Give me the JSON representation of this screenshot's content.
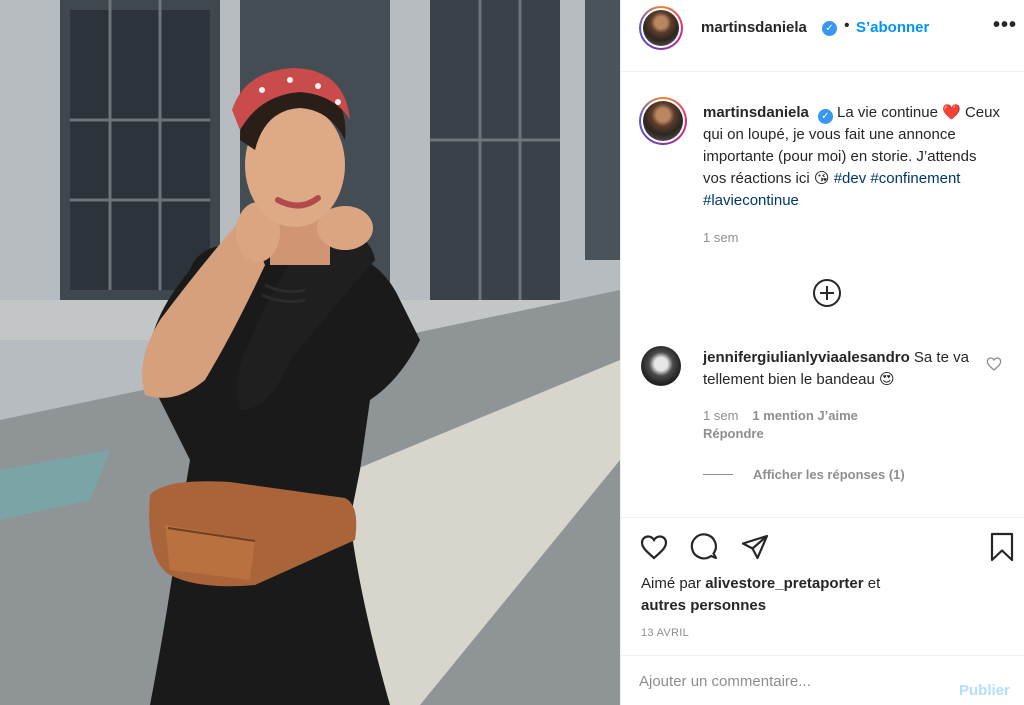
{
  "post": {
    "image_alt": "Femme en combinaison noire avec bandeau et sac banane, dans une rue ensoleillée"
  },
  "header": {
    "username": "martinsdaniela",
    "separator": "•",
    "follow_label": "S’abonner",
    "more_label": "•••"
  },
  "caption": {
    "username": "martinsdaniela",
    "text_line1": "La vie continue ❤️",
    "text_body": "Ceux qui on loupé, je vous fait une annonce importante (pour moi) en storie. J’attends vos réactions ici 😘",
    "hashtags": [
      "#dev",
      "#confinement",
      "#laviecontinue"
    ],
    "time": "1 sem"
  },
  "comments": [
    {
      "username": "jennifergiulianlyviaalesandro",
      "text": "Sa te va tellement bien le bandeau 😍",
      "time": "1 sem",
      "likes": "1 mention J’aime",
      "reply_label": "Répondre",
      "view_replies_label": "Afficher les réponses (1)"
    }
  ],
  "actions": {
    "liked_prefix": "Aimé par",
    "liked_user": "alivestore_pretaporter",
    "liked_conj": "et",
    "liked_others": "autres personnes",
    "date": "13 AVRIL"
  },
  "add_comment": {
    "placeholder": "Ajouter un commentaire...",
    "publish_label": "Publier"
  },
  "icons": {
    "verified": "verified-badge-icon",
    "like": "heart-icon",
    "comment": "comment-bubble-icon",
    "share": "paper-plane-icon",
    "save": "bookmark-icon",
    "load_more": "plus-circle-icon"
  },
  "colors": {
    "link_blue": "#0095f6",
    "hashtag": "#00376b",
    "muted": "#8e8e8e",
    "publish_disabled": "#b2dffc"
  }
}
